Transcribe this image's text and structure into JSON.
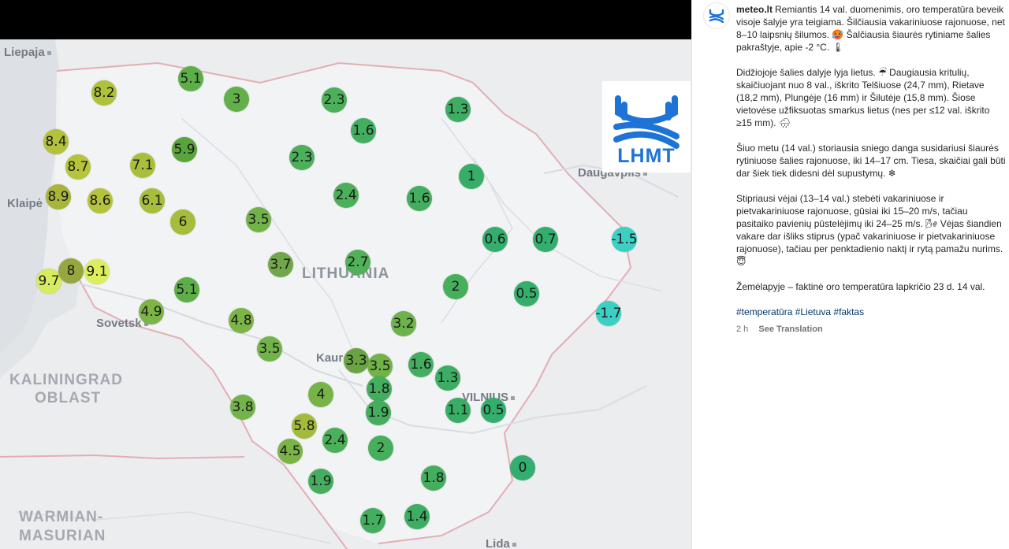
{
  "map": {
    "places": [
      {
        "name": "Liepaja",
        "kind": "city",
        "cls": "place",
        "dot": true
      },
      {
        "name": "Klaipė",
        "kind": "city",
        "cls": "place",
        "dot": false
      },
      {
        "name": "Sovetsk",
        "kind": "city",
        "cls": "place",
        "dot": true
      },
      {
        "name": "Kaur",
        "kind": "city",
        "cls": "place",
        "dot": false
      },
      {
        "name": "VILNIUS",
        "kind": "capital",
        "cls": "place",
        "dot": true
      },
      {
        "name": "Daugavpils",
        "kind": "city",
        "cls": "place",
        "dot": true
      },
      {
        "name": "Lida",
        "kind": "city",
        "cls": "place",
        "dot": true
      },
      {
        "name": "LITHUANIA",
        "kind": "country",
        "cls": "place big",
        "dot": false
      },
      {
        "name": "KALININGRAD",
        "kind": "region",
        "cls": "place country",
        "dot": false
      },
      {
        "name": "OBLAST",
        "kind": "region",
        "cls": "place country",
        "dot": false
      },
      {
        "name": "WARMIAN-",
        "kind": "region",
        "cls": "place country",
        "dot": false
      },
      {
        "name": "MASURIAN",
        "kind": "region",
        "cls": "place country",
        "dot": false
      }
    ],
    "temperature_unit": "°C",
    "readings": [
      {
        "label": "8.2",
        "value": 8.2,
        "color": "#b0c13a"
      },
      {
        "label": "5.1",
        "value": 5.1,
        "color": "#5cae47"
      },
      {
        "label": "3",
        "value": 3,
        "color": "#63b04a"
      },
      {
        "label": "2.3",
        "value": 2.3,
        "color": "#4caf59"
      },
      {
        "label": "1.3",
        "value": 1.3,
        "color": "#3cad63"
      },
      {
        "label": "1.6",
        "value": 1.6,
        "color": "#43ae5f"
      },
      {
        "label": "8.4",
        "value": 8.4,
        "color": "#b4c13a"
      },
      {
        "label": "5.9",
        "value": 5.9,
        "color": "#5aa43c"
      },
      {
        "label": "8.7",
        "value": 8.7,
        "color": "#b6c43b"
      },
      {
        "label": "7.1",
        "value": 7.1,
        "color": "#a9bf3c"
      },
      {
        "label": "2.3",
        "value": 2.3,
        "color": "#4caf59"
      },
      {
        "label": "1",
        "value": 1,
        "color": "#37ad67"
      },
      {
        "label": "8.9",
        "value": 8.9,
        "color": "#a8b43a"
      },
      {
        "label": "8.6",
        "value": 8.6,
        "color": "#b4c23c"
      },
      {
        "label": "6.1",
        "value": 6.1,
        "color": "#a7bd3c"
      },
      {
        "label": "2.4",
        "value": 2.4,
        "color": "#4caf59"
      },
      {
        "label": "1.6",
        "value": 1.6,
        "color": "#43ae5f"
      },
      {
        "label": "6",
        "value": 6,
        "color": "#a5bc3c"
      },
      {
        "label": "3.5",
        "value": 3.5,
        "color": "#72b349"
      },
      {
        "label": "0.6",
        "value": 0.6,
        "color": "#34ae6c"
      },
      {
        "label": "0.7",
        "value": 0.7,
        "color": "#34ae6c"
      },
      {
        "label": "-1.5",
        "value": -1.5,
        "color": "#3ccfc4"
      },
      {
        "label": "3.7",
        "value": 3.7,
        "color": "#72a64a"
      },
      {
        "label": "2.7",
        "value": 2.7,
        "color": "#51b058"
      },
      {
        "label": "9.7",
        "value": 9.7,
        "color": "#d6ec5e"
      },
      {
        "label": "8",
        "value": 8,
        "color": "#98a63f"
      },
      {
        "label": "9.1",
        "value": 9.1,
        "color": "#dcee5c"
      },
      {
        "label": "5.1",
        "value": 5.1,
        "color": "#5cae47"
      },
      {
        "label": "2",
        "value": 2,
        "color": "#47af5c"
      },
      {
        "label": "0.5",
        "value": 0.5,
        "color": "#34ae6c"
      },
      {
        "label": "4.9",
        "value": 4.9,
        "color": "#7cb447"
      },
      {
        "label": "4.8",
        "value": 4.8,
        "color": "#7cb447"
      },
      {
        "label": "3.2",
        "value": 3.2,
        "color": "#6db24a"
      },
      {
        "label": "-1.7",
        "value": -1.7,
        "color": "#3ccfc4"
      },
      {
        "label": "3.5",
        "value": 3.5,
        "color": "#72b349"
      },
      {
        "label": "3.3",
        "value": 3.3,
        "color": "#6aa343"
      },
      {
        "label": "3.5",
        "value": 3.5,
        "color": "#72b349"
      },
      {
        "label": "1.6",
        "value": 1.6,
        "color": "#43ae5f"
      },
      {
        "label": "1.3",
        "value": 1.3,
        "color": "#3cad63"
      },
      {
        "label": "1.8",
        "value": 1.8,
        "color": "#45ae5e"
      },
      {
        "label": "4",
        "value": 4,
        "color": "#76b348"
      },
      {
        "label": "3.8",
        "value": 3.8,
        "color": "#74b349"
      },
      {
        "label": "1.9",
        "value": 1.9,
        "color": "#45ae5e"
      },
      {
        "label": "1.1",
        "value": 1.1,
        "color": "#39ad65"
      },
      {
        "label": "0.5",
        "value": 0.5,
        "color": "#34ae6c"
      },
      {
        "label": "5.8",
        "value": 5.8,
        "color": "#a2bb3d"
      },
      {
        "label": "2.4",
        "value": 2.4,
        "color": "#4caf59"
      },
      {
        "label": "2",
        "value": 2,
        "color": "#47af5c"
      },
      {
        "label": "4.5",
        "value": 4.5,
        "color": "#7ab447"
      },
      {
        "label": "0",
        "value": 0,
        "color": "#33ad70"
      },
      {
        "label": "1.9",
        "value": 1.9,
        "color": "#45ae5e"
      },
      {
        "label": "1.8",
        "value": 1.8,
        "color": "#45ae5e"
      },
      {
        "label": "1.7",
        "value": 1.7,
        "color": "#44ae5f"
      },
      {
        "label": "1.4",
        "value": 1.4,
        "color": "#3dad62"
      }
    ],
    "logo_text": "LHMT",
    "accent_color": "#1e73d6"
  },
  "post": {
    "username": "meteo.lt",
    "paragraphs": [
      "Remiantis 14 val. duomenimis, oro temperatūra beveik visoje šalyje yra teigiama. Šilčiausia vakariniuose rajonuose, net 8–10 laipsnių šilumos. 🥵 Šalčiausia šiaurės rytiniame šalies pakraštyje, apie -2 °C. 🌡",
      "Didžiojoje šalies dalyje lyja lietus. ☔ Daugiausia kritulių, skaičiuojant nuo 8 val., iškrito Telšiuose (24,7 mm), Rietave (18,2 mm), Plungėje (16 mm) ir Šilutėje (15,8 mm). Šiose vietovėse užfiksuotas smarkus lietus (nes per ≤12 val. iškrito ≥15 mm). 🌧",
      "Šiuo metu (14 val.) storiausia sniego danga susidariusi šiaurės rytiniuose šalies rajonuose, iki 14–17 cm. Tiesa, skaičiai gali būti dar šiek tiek didesni dėl supustymų. ❄",
      "Stipriausi vėjai (13–14 val.) stebėti vakariniuose ir pietvakariniuose rajonuose, gūsiai iki 15–20 m/s, tačiau pasitaiko pavienių pūstelėjimų iki 24–25 m/s. 🌬 Vėjas šiandien vakare dar išliks stiprus (ypač vakariniuose ir pietvakariniuose rajonuose), tačiau per penktadienio naktį ir rytą pamažu nurims. 😇",
      "Žemėlapyje – faktinė oro temperatūra lapkričio 23 d. 14 val."
    ],
    "hashtags": "#temperatūra #Lietuva #faktas",
    "time_ago": "2 h",
    "translate_label": "See Translation"
  }
}
